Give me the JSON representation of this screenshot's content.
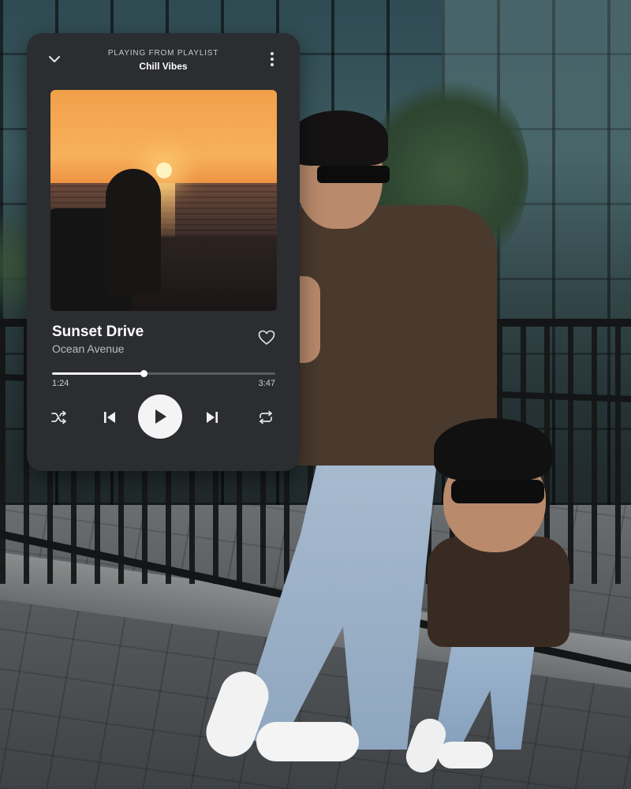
{
  "player": {
    "context_label": "PLAYING FROM PLAYLIST",
    "context_name": "Chill Vibes",
    "track": {
      "title": "Sunset Drive",
      "artist": "Ocean Avenue"
    },
    "progress": {
      "elapsed": "1:24",
      "total": "3:47",
      "fraction": 0.41
    },
    "icons": {
      "collapse": "chevron-down-icon",
      "more": "more-vertical-icon",
      "like": "heart-icon",
      "shuffle": "shuffle-icon",
      "previous": "skip-previous-icon",
      "play": "play-icon",
      "next": "skip-next-icon",
      "repeat": "repeat-icon"
    },
    "colors": {
      "card_background": "#2b2d30",
      "accent": "#f4f4f4",
      "secondary_text": "#bdbdbd"
    }
  }
}
